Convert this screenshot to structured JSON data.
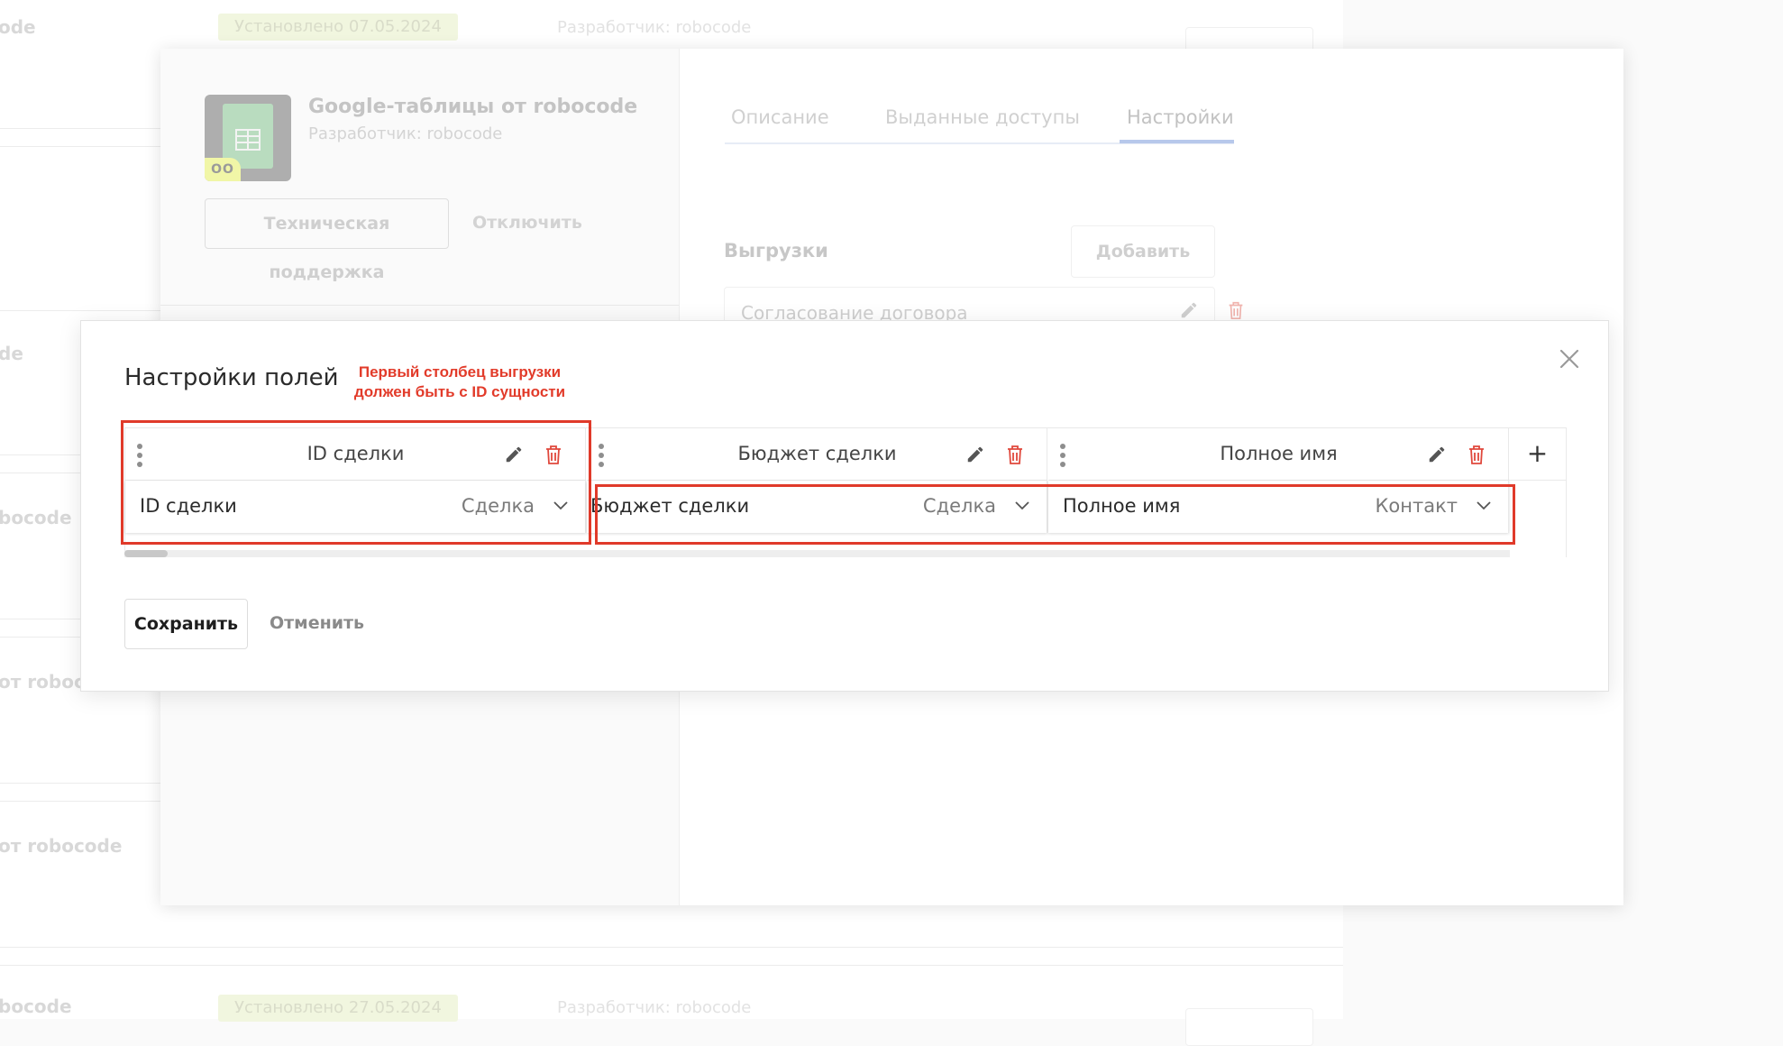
{
  "background": {
    "rows": [
      {
        "name": "ode",
        "badge": "Установлено 07.05.2024",
        "developer": "Разработчик: robocode"
      },
      {
        "name": "de"
      },
      {
        "name": "bocode"
      },
      {
        "name": "от robocode"
      },
      {
        "name": "от robocode"
      },
      {
        "name": "bocode",
        "badge": "Установлено 27.05.2024",
        "developer": "Разработчик: robocode"
      }
    ]
  },
  "app_panel": {
    "app_name": "Google-таблицы от robocode",
    "developer": "Разработчик: robocode",
    "icon_tag": "OO",
    "support_button": "Техническая поддержка",
    "disable_button": "Отключить",
    "tabs": [
      {
        "label": "Описание",
        "active": false
      },
      {
        "label": "Выданные доступы",
        "active": false
      },
      {
        "label": "Настройки",
        "active": true
      }
    ],
    "uploads_title": "Выгрузки",
    "add_button": "Добавить",
    "uploads": [
      {
        "label": "Согласование договора"
      }
    ]
  },
  "modal": {
    "title": "Настройки полей",
    "note_line1": "Первый столбец выгрузки",
    "note_line2": "должен быть с ID сущности",
    "columns": [
      {
        "header": "ID сделки",
        "field": "ID сделки",
        "entity": "Сделка"
      },
      {
        "header": "Бюджет сделки",
        "field": "Бюджет сделки",
        "entity": "Сделка"
      },
      {
        "header": "Полное имя",
        "field": "Полное имя",
        "entity": "Контакт"
      }
    ],
    "add_column": "+",
    "save_button": "Сохранить",
    "cancel_button": "Отменить"
  },
  "colors": {
    "accent_red": "#e03a2a",
    "delete_icon": "#e0483c",
    "tab_underline": "#b7c8eb"
  }
}
